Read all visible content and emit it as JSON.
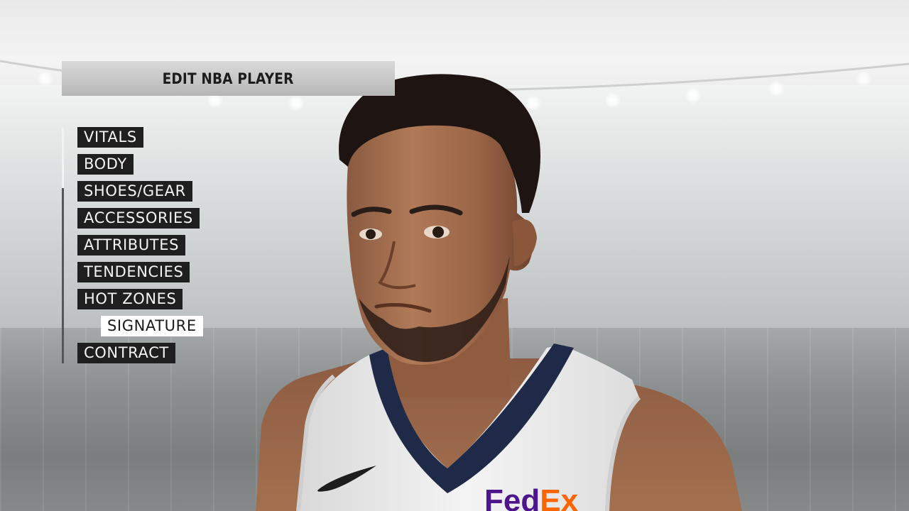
{
  "header": {
    "title": "EDIT NBA PLAYER"
  },
  "menu": {
    "selected_index": 7,
    "items": [
      {
        "label": "VITALS"
      },
      {
        "label": "BODY"
      },
      {
        "label": "SHOES/GEAR"
      },
      {
        "label": "ACCESSORIES"
      },
      {
        "label": "ATTRIBUTES"
      },
      {
        "label": "TENDENCIES"
      },
      {
        "label": "HOT ZONES"
      },
      {
        "label": "SIGNATURE"
      },
      {
        "label": "CONTRACT"
      }
    ]
  },
  "jersey": {
    "sponsor_logo_text": "FedEx"
  },
  "colors": {
    "menu_item_bg": "#1f1f1f",
    "menu_item_text": "#f4f4f4",
    "menu_selected_bg": "#ffffff",
    "menu_selected_text": "#1a1a1a",
    "jersey_white": "#eeeeee",
    "jersey_trim_navy": "#1f2a48",
    "fedex_purple": "#4d148c",
    "fedex_orange": "#ff6600"
  }
}
